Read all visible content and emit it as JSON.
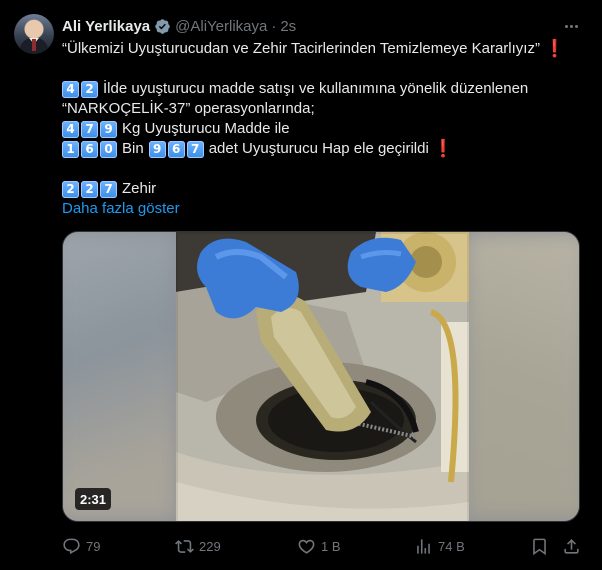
{
  "author": {
    "name": "Ali Yerlikaya",
    "handle": "@AliYerlikaya",
    "time": "2s"
  },
  "tweet": {
    "line1": "“Ülkemizi Uyuşturucudan ve Zehir Tacirlerinden Temizlemeye Kararlıyız”",
    "line2_digits": [
      "4",
      "2"
    ],
    "line2": "İlde uyuşturucu madde satışı ve kullanımına yönelik düzenlenen",
    "line3": "“NARKOÇELİK-37” operasyonlarında;",
    "line4_digits": [
      "4",
      "7",
      "9"
    ],
    "line4": "Kg Uyuşturucu Madde ile",
    "line5_digits_a": [
      "1",
      "6",
      "0"
    ],
    "line5_mid": "Bin",
    "line5_digits_b": [
      "9",
      "6",
      "7"
    ],
    "line5": "adet Uyuşturucu Hap ele geçirildi",
    "line6_digits": [
      "2",
      "2",
      "7"
    ],
    "line6": "Zehir",
    "show_more": "Daha fazla göster",
    "exclamation": "❗"
  },
  "media": {
    "duration": "2:31"
  },
  "actions": {
    "replies": "79",
    "retweets": "229",
    "likes": "1 B",
    "views": "74 B"
  },
  "icons": {
    "verified": "verified-badge-icon",
    "more": "more-options-icon",
    "reply": "reply-icon",
    "retweet": "retweet-icon",
    "like": "heart-icon",
    "views": "views-icon",
    "bookmark": "bookmark-icon",
    "share": "share-icon"
  },
  "colors": {
    "background": "#000000",
    "text": "#e7e9ea",
    "muted": "#71767b",
    "link": "#1d9bf0",
    "verified": "#829aab",
    "accent_red": "#f4212e"
  }
}
